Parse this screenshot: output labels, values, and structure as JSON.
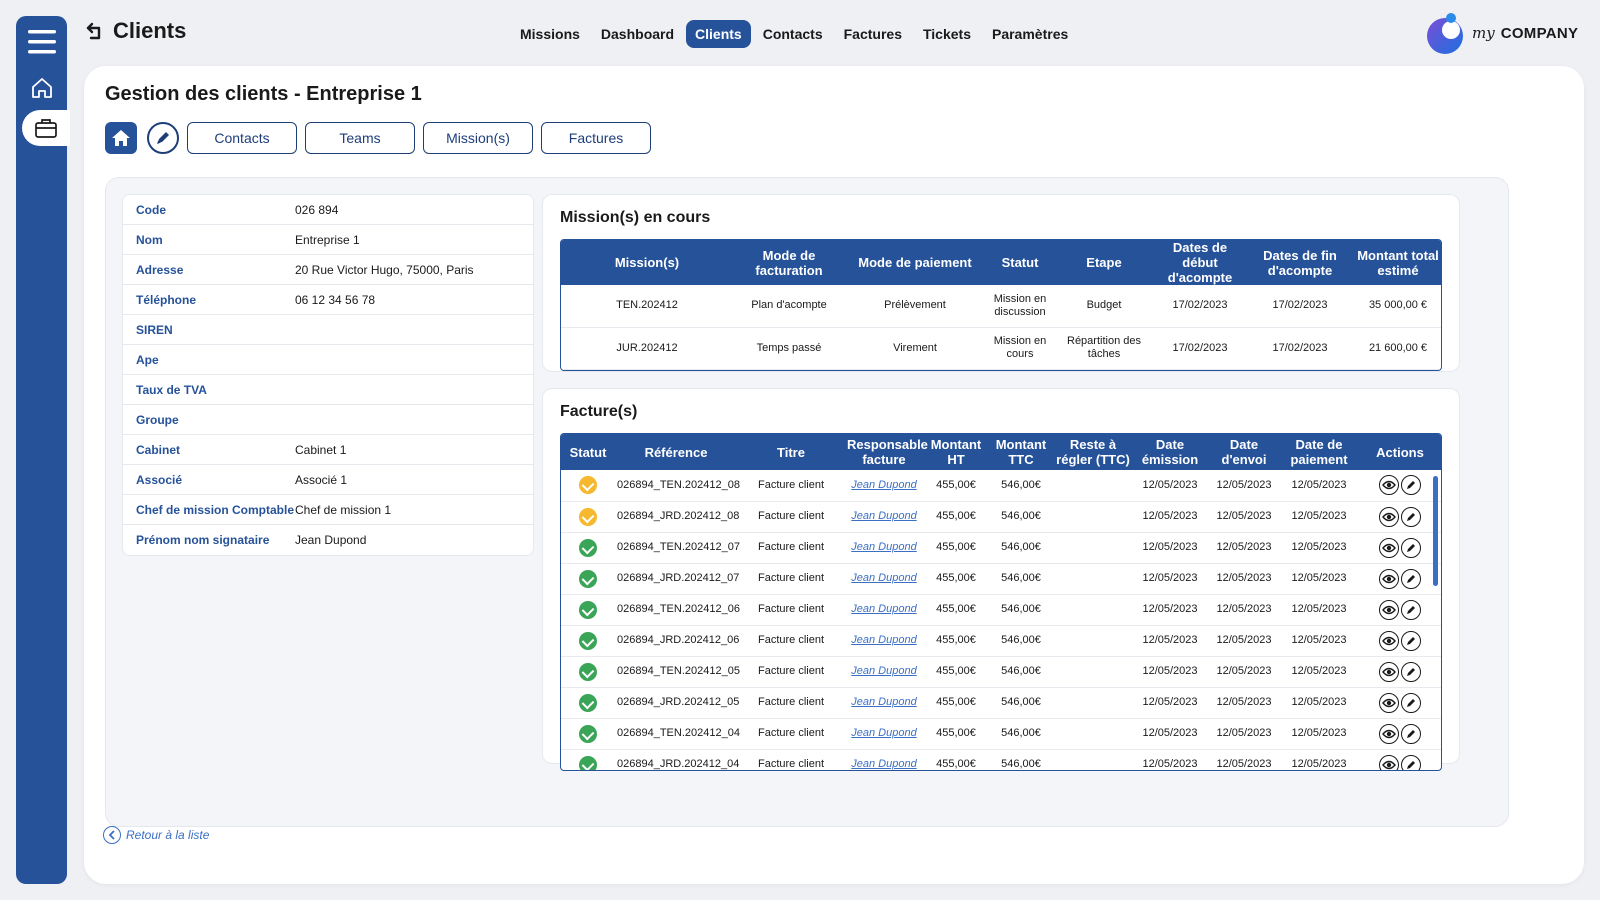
{
  "app": {
    "page_title": "Clients",
    "brand_my": "my",
    "brand_company": "COMPANY"
  },
  "nav": [
    {
      "label": "Missions",
      "active": false
    },
    {
      "label": "Dashboard",
      "active": false
    },
    {
      "label": "Clients",
      "active": true
    },
    {
      "label": "Contacts",
      "active": false
    },
    {
      "label": "Factures",
      "active": false
    },
    {
      "label": "Tickets",
      "active": false
    },
    {
      "label": "Paramètres",
      "active": false
    }
  ],
  "main": {
    "title": "Gestion des clients - Entreprise 1",
    "toolbar": {
      "contacts": "Contacts",
      "teams": "Teams",
      "missions": "Mission(s)",
      "factures": "Factures"
    },
    "back_label": "Retour à la liste"
  },
  "client_info": [
    {
      "label": "Code",
      "value": "026 894"
    },
    {
      "label": "Nom",
      "value": "Entreprise 1"
    },
    {
      "label": "Adresse",
      "value": "20 Rue Victor Hugo, 75000, Paris"
    },
    {
      "label": "Téléphone",
      "value": "06 12 34 56 78"
    },
    {
      "label": "SIREN",
      "value": ""
    },
    {
      "label": "Ape",
      "value": ""
    },
    {
      "label": "Taux de TVA",
      "value": ""
    },
    {
      "label": "Groupe",
      "value": ""
    },
    {
      "label": "Cabinet",
      "value": "Cabinet 1"
    },
    {
      "label": "Associé",
      "value": "Associé 1"
    },
    {
      "label": "Chef de mission Comptable",
      "value": "Chef de mission 1"
    },
    {
      "label": "Prénom nom signataire",
      "value": "Jean Dupond"
    }
  ],
  "missions": {
    "title": "Mission(s) en cours",
    "headers": [
      "Mission(s)",
      "Mode de facturation",
      "Mode de paiement",
      "Statut",
      "Etape",
      "Dates de début d'acompte",
      "Dates de fin d'acompte",
      "Montant total estimé"
    ],
    "rows": [
      [
        "TEN.202412",
        "Plan d'acompte",
        "Prélèvement",
        "Mission en discussion",
        "Budget",
        "17/02/2023",
        "17/02/2023",
        "35 000,00 €"
      ],
      [
        "JUR.202412",
        "Temps passé",
        "Virement",
        "Mission en cours",
        "Répartition des tâches",
        "17/02/2023",
        "17/02/2023",
        "21 600,00 €"
      ]
    ]
  },
  "invoices": {
    "title": "Facture(s)",
    "headers": [
      "Statut",
      "Référence",
      "Titre",
      "Responsable facture",
      "Montant HT",
      "Montant TTC",
      "Reste à régler (TTC)",
      "Date émission",
      "Date d'envoi",
      "Date de paiement",
      "Actions"
    ],
    "status_colors": {
      "pending": "#f5b82e",
      "paid": "#3aa457"
    },
    "rows": [
      {
        "status": "pending",
        "ref": "026894_TEN.202412_08",
        "titre": "Facture client",
        "resp": "Jean Dupond",
        "ht": "455,00€",
        "ttc": "546,00€",
        "reste": "",
        "emission": "12/05/2023",
        "envoi": "12/05/2023",
        "paiement": "12/05/2023"
      },
      {
        "status": "pending",
        "ref": "026894_JRD.202412_08",
        "titre": "Facture client",
        "resp": "Jean Dupond",
        "ht": "455,00€",
        "ttc": "546,00€",
        "reste": "",
        "emission": "12/05/2023",
        "envoi": "12/05/2023",
        "paiement": "12/05/2023"
      },
      {
        "status": "paid",
        "ref": "026894_TEN.202412_07",
        "titre": "Facture client",
        "resp": "Jean Dupond",
        "ht": "455,00€",
        "ttc": "546,00€",
        "reste": "",
        "emission": "12/05/2023",
        "envoi": "12/05/2023",
        "paiement": "12/05/2023"
      },
      {
        "status": "paid",
        "ref": "026894_JRD.202412_07",
        "titre": "Facture client",
        "resp": "Jean Dupond",
        "ht": "455,00€",
        "ttc": "546,00€",
        "reste": "",
        "emission": "12/05/2023",
        "envoi": "12/05/2023",
        "paiement": "12/05/2023"
      },
      {
        "status": "paid",
        "ref": "026894_TEN.202412_06",
        "titre": "Facture client",
        "resp": "Jean Dupond",
        "ht": "455,00€",
        "ttc": "546,00€",
        "reste": "",
        "emission": "12/05/2023",
        "envoi": "12/05/2023",
        "paiement": "12/05/2023"
      },
      {
        "status": "paid",
        "ref": "026894_JRD.202412_06",
        "titre": "Facture client",
        "resp": "Jean Dupond",
        "ht": "455,00€",
        "ttc": "546,00€",
        "reste": "",
        "emission": "12/05/2023",
        "envoi": "12/05/2023",
        "paiement": "12/05/2023"
      },
      {
        "status": "paid",
        "ref": "026894_TEN.202412_05",
        "titre": "Facture client",
        "resp": "Jean Dupond",
        "ht": "455,00€",
        "ttc": "546,00€",
        "reste": "",
        "emission": "12/05/2023",
        "envoi": "12/05/2023",
        "paiement": "12/05/2023"
      },
      {
        "status": "paid",
        "ref": "026894_JRD.202412_05",
        "titre": "Facture client",
        "resp": "Jean Dupond",
        "ht": "455,00€",
        "ttc": "546,00€",
        "reste": "",
        "emission": "12/05/2023",
        "envoi": "12/05/2023",
        "paiement": "12/05/2023"
      },
      {
        "status": "paid",
        "ref": "026894_TEN.202412_04",
        "titre": "Facture client",
        "resp": "Jean Dupond",
        "ht": "455,00€",
        "ttc": "546,00€",
        "reste": "",
        "emission": "12/05/2023",
        "envoi": "12/05/2023",
        "paiement": "12/05/2023"
      },
      {
        "status": "paid",
        "ref": "026894_JRD.202412_04",
        "titre": "Facture client",
        "resp": "Jean Dupond",
        "ht": "455,00€",
        "ttc": "546,00€",
        "reste": "",
        "emission": "12/05/2023",
        "envoi": "12/05/2023",
        "paiement": "12/05/2023"
      }
    ]
  }
}
